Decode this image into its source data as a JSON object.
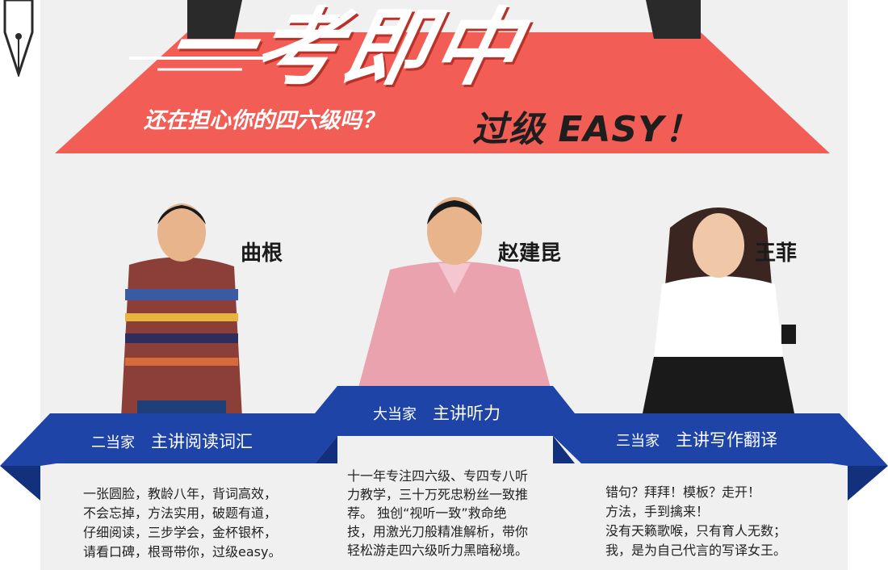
{
  "banner": {
    "title": "一考即中",
    "question": "还在担心你的四六级吗？",
    "pass_text": "过级 EASY！",
    "colors": {
      "banner_red": "#f25d55",
      "ribbon_blue": "#1e44a8",
      "ribbon_dark": "#12307c"
    }
  },
  "teachers": [
    {
      "name": "曲根",
      "rank": "二当家",
      "subject": "主讲阅读词汇",
      "desc": [
        "一张圆脸，教龄八年，背词高效，",
        "不会忘掉，方法实用，破题有道，",
        "仔细阅读，三步学会，金杯银杯，",
        "请看口碑，根哥带你，过级easy。"
      ]
    },
    {
      "name": "赵建昆",
      "rank": "大当家",
      "subject": "主讲听力",
      "desc": [
        "十一年专注四六级、专四专八听",
        "力教学，三十万死忠粉丝一致推",
        "荐。 独创“视听一致”救命绝",
        "技，用激光刀般精准解析，带你",
        "轻松游走四六级听力黑暗秘境。"
      ]
    },
    {
      "name": "王菲",
      "rank": "三当家",
      "subject": "主讲写作翻译",
      "desc": [
        "错句？拜拜！模板？走开！",
        "方法，手到擒来！",
        "没有天籁歌喉，只有育人无数；",
        "我，是为自己代言的写译女王。"
      ]
    }
  ]
}
